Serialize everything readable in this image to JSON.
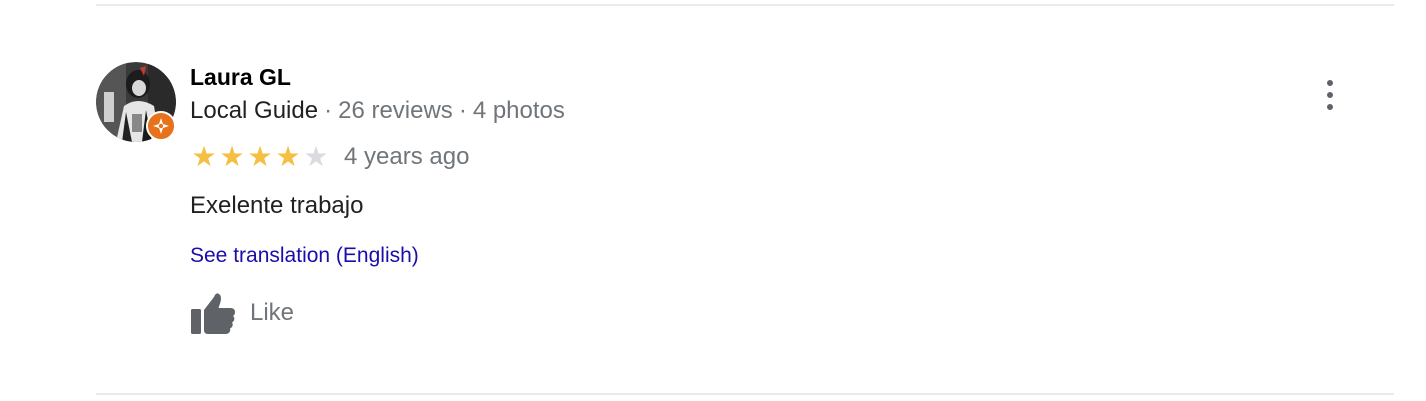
{
  "review": {
    "author": {
      "name": "Laura GL",
      "badge": "Local Guide",
      "reviews_count": "26 reviews",
      "photos_count": "4 photos",
      "avatar_icon": "user-photo-avatar",
      "badge_icon": "local-guide-star-icon",
      "badge_color": "#e8711c"
    },
    "rating": 4,
    "rating_max": 5,
    "time": "4 years ago",
    "separator": "·",
    "text": "Exelente trabajo",
    "translate_link": "See translation (English)",
    "like_label": "Like",
    "like_icon": "thumbs-up-icon",
    "more_icon": "more-vertical-icon"
  },
  "colors": {
    "star_on": "#f4bf42",
    "star_off": "#dadce0",
    "link": "#1a0dab",
    "muted": "#70757a"
  }
}
